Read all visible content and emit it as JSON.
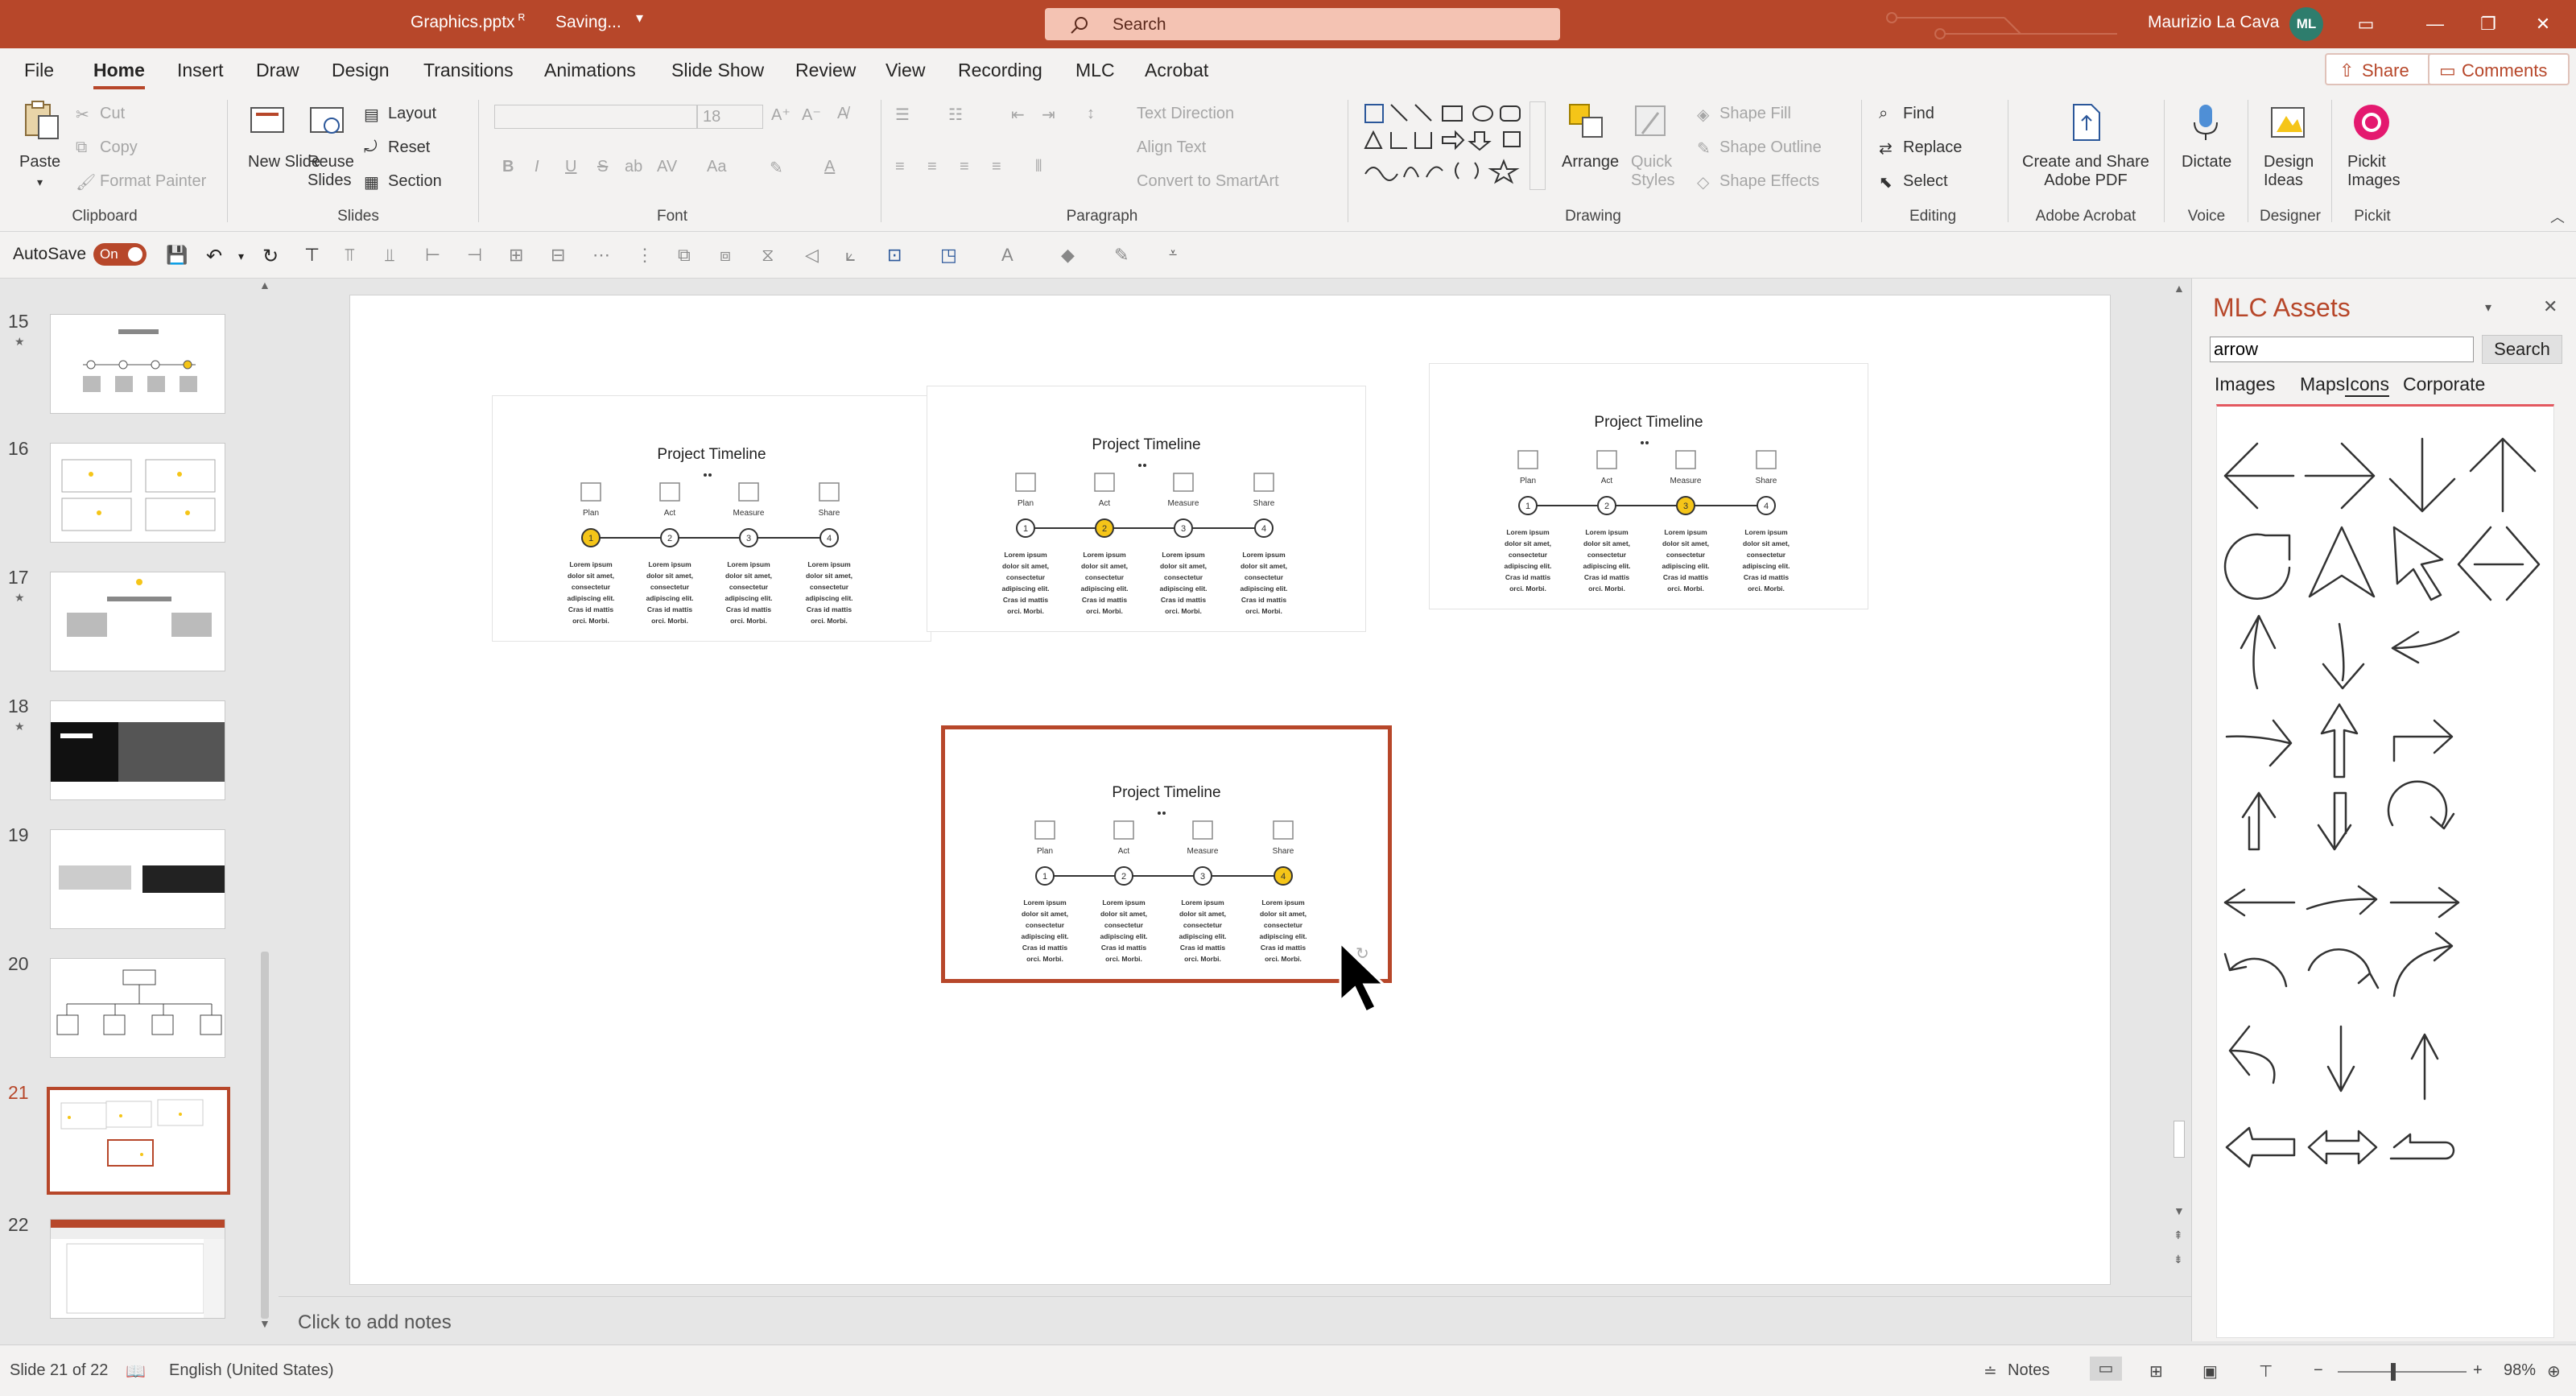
{
  "window": {
    "file_name": "Graphics.pptx",
    "save_status": "Saving...",
    "search_placeholder": "Search",
    "user_name": "Maurizio La Cava",
    "user_initials": "ML"
  },
  "menu": {
    "tabs": [
      "File",
      "Home",
      "Insert",
      "Draw",
      "Design",
      "Transitions",
      "Animations",
      "Slide Show",
      "Review",
      "View",
      "Recording",
      "MLC",
      "Acrobat"
    ],
    "active_tab": "Home",
    "share_label": "Share",
    "comments_label": "Comments"
  },
  "ribbon": {
    "clipboard": {
      "paste": "Paste",
      "cut": "Cut",
      "copy": "Copy",
      "format_painter": "Format Painter",
      "label": "Clipboard"
    },
    "slides": {
      "new_slide": "New Slide",
      "reuse_slides": "Reuse Slides",
      "layout": "Layout",
      "reset": "Reset",
      "section": "Section",
      "label": "Slides"
    },
    "font": {
      "size": "18",
      "label": "Font"
    },
    "paragraph": {
      "text_direction": "Text Direction",
      "align_text": "Align Text",
      "convert_smartart": "Convert to SmartArt",
      "label": "Paragraph"
    },
    "drawing": {
      "arrange": "Arrange",
      "quick_styles": "Quick Styles",
      "shape_fill": "Shape Fill",
      "shape_outline": "Shape Outline",
      "shape_effects": "Shape Effects",
      "label": "Drawing"
    },
    "editing": {
      "find": "Find",
      "replace": "Replace",
      "select": "Select",
      "label": "Editing"
    },
    "adobe": {
      "create_share": "Create and Share Adobe PDF",
      "label": "Adobe Acrobat"
    },
    "voice": {
      "dictate": "Dictate",
      "label": "Voice"
    },
    "designer": {
      "design_ideas": "Design Ideas",
      "label": "Designer"
    },
    "pickit": {
      "pickit_images": "Pickit Images",
      "label": "Pickit"
    }
  },
  "qat": {
    "autosave_label": "AutoSave",
    "autosave_state": "On"
  },
  "thumbnails": [
    {
      "num": "15",
      "star": true,
      "selected": false
    },
    {
      "num": "16",
      "star": false,
      "selected": false
    },
    {
      "num": "17",
      "star": true,
      "selected": false
    },
    {
      "num": "18",
      "star": true,
      "selected": false
    },
    {
      "num": "19",
      "star": false,
      "selected": false
    },
    {
      "num": "20",
      "star": false,
      "selected": false
    },
    {
      "num": "21",
      "star": false,
      "selected": true
    },
    {
      "num": "22",
      "star": false,
      "selected": false
    }
  ],
  "slide": {
    "timelines": [
      {
        "title": "Project Timeline",
        "active_step": 1
      },
      {
        "title": "Project Timeline",
        "active_step": 2
      },
      {
        "title": "Project Timeline",
        "active_step": 3
      },
      {
        "title": "Project Timeline",
        "active_step": 4
      }
    ],
    "steps": [
      "Plan",
      "Act",
      "Measure",
      "Share"
    ],
    "numbers": [
      "1",
      "2",
      "3",
      "4"
    ],
    "lorem": [
      "Lorem ipsum",
      "dolor sit amet,",
      "consectetur",
      "adipiscing elit.",
      "Cras id mattis",
      "orci. Morbi."
    ],
    "accent_color": "#f5c518",
    "selection_color": "#b7472a"
  },
  "notes_placeholder": "Click to add notes",
  "mlc": {
    "title": "MLC Assets",
    "search_value": "arrow",
    "search_button": "Search",
    "tabs": [
      "Images",
      "Maps",
      "Icons",
      "Corporate"
    ],
    "active_tab": "Icons",
    "icons": [
      "arrow-left-icon",
      "arrow-right-icon",
      "arrow-down-icon",
      "arrow-up-icon",
      "rotate-cw-icon",
      "navigation-icon",
      "cursor-icon",
      "chevrons-icon",
      "curved-arrow-up-icon",
      "curved-arrow-down-icon",
      "curved-arrow-left-icon",
      "curved-arrow-right-icon",
      "arrow-up-bold-icon",
      "u-turn-right-icon",
      "u-turn-up-icon",
      "u-turn-down-icon",
      "rotate-half-icon",
      "long-arrow-left-icon",
      "long-arrow-right-curve-icon",
      "long-arrow-right-icon",
      "undo-arc-icon",
      "redo-arc-icon",
      "redo-curve-icon",
      "reply-icon",
      "thin-arrow-down-icon",
      "thin-arrow-up-icon",
      "wide-arrow-left-icon",
      "double-arrow-icon",
      "return-left-icon"
    ]
  },
  "status": {
    "slide_info": "Slide 21 of 22",
    "language": "English (United States)",
    "notes": "Notes",
    "zoom": "98%"
  }
}
